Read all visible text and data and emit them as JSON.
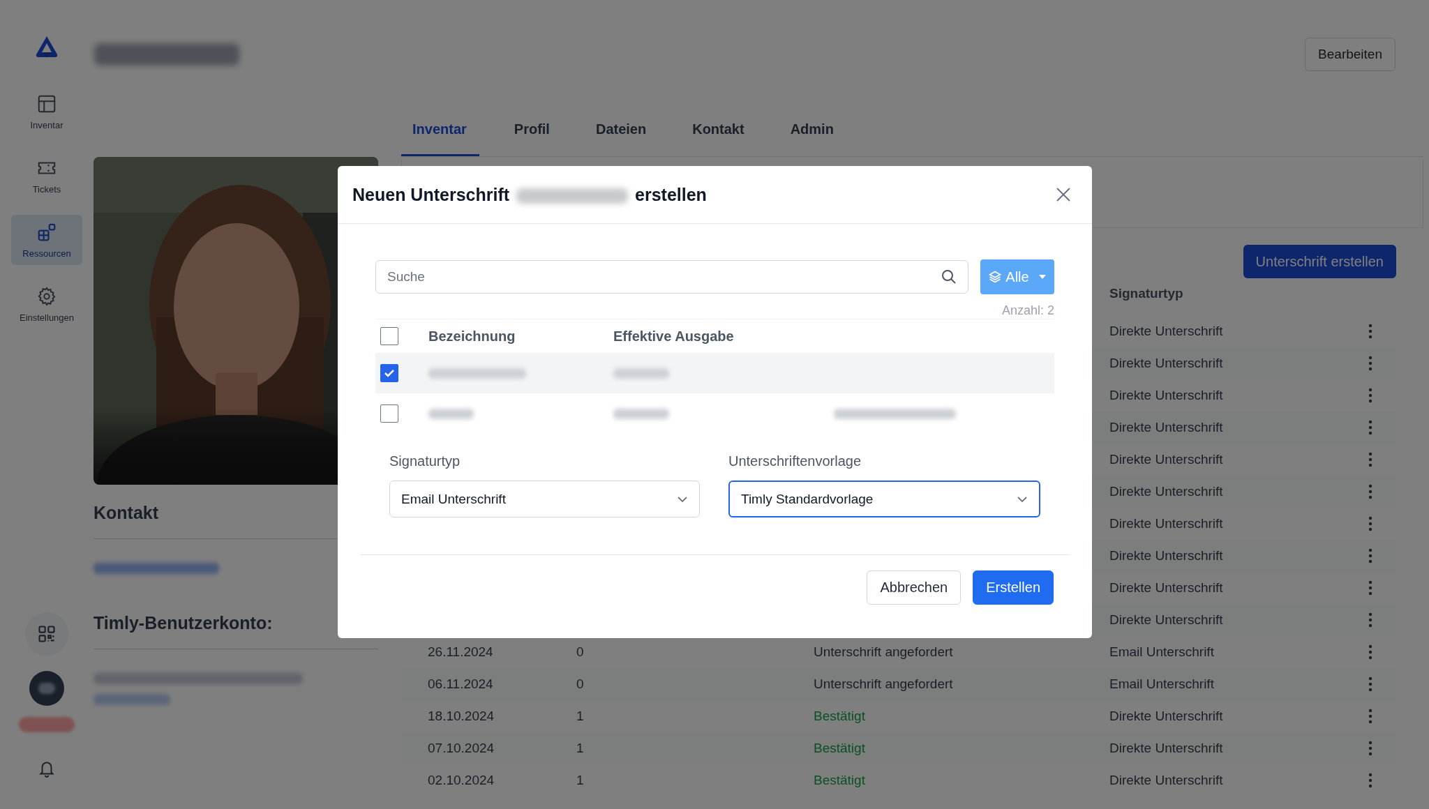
{
  "sidebar": {
    "items": [
      {
        "label": "Inventar",
        "selected": false
      },
      {
        "label": "Tickets",
        "selected": false
      },
      {
        "label": "Ressourcen",
        "selected": true
      },
      {
        "label": "Einstellungen",
        "selected": false
      }
    ]
  },
  "header": {
    "edit_button": "Bearbeiten"
  },
  "tabs": [
    {
      "label": "Inventar",
      "selected": true
    },
    {
      "label": "Profil",
      "selected": false
    },
    {
      "label": "Dateien",
      "selected": false
    },
    {
      "label": "Kontakt",
      "selected": false
    },
    {
      "label": "Admin",
      "selected": false
    }
  ],
  "profile": {
    "contact_heading": "Kontakt",
    "account_heading": "Timly-Benutzerkonto:"
  },
  "signatures": {
    "create_button": "Unterschrift erstellen",
    "type_column": "Signaturtyp",
    "rows": [
      {
        "type": "Direkte Unterschrift"
      },
      {
        "type": "Direkte Unterschrift"
      },
      {
        "type": "Direkte Unterschrift"
      },
      {
        "type": "Direkte Unterschrift"
      },
      {
        "type": "Direkte Unterschrift"
      },
      {
        "type": "Direkte Unterschrift"
      },
      {
        "type": "Direkte Unterschrift"
      },
      {
        "type": "Direkte Unterschrift"
      },
      {
        "type": "Direkte Unterschrift"
      },
      {
        "type": "Direkte Unterschrift"
      },
      {
        "date": "26.11.2024",
        "count": "0",
        "status": "Unterschrift angefordert",
        "confirmed": false,
        "type": "Email Unterschrift"
      },
      {
        "date": "06.11.2024",
        "count": "0",
        "status": "Unterschrift angefordert",
        "confirmed": false,
        "type": "Email Unterschrift"
      },
      {
        "date": "18.10.2024",
        "count": "1",
        "status": "Bestätigt",
        "confirmed": true,
        "type": "Direkte Unterschrift"
      },
      {
        "date": "07.10.2024",
        "count": "1",
        "status": "Bestätigt",
        "confirmed": true,
        "type": "Direkte Unterschrift"
      },
      {
        "date": "02.10.2024",
        "count": "1",
        "status": "Bestätigt",
        "confirmed": true,
        "type": "Direkte Unterschrift"
      }
    ]
  },
  "dialog": {
    "title_before": "Neuen Unterschrift",
    "title_after": "erstellen",
    "search": {
      "placeholder": "Suche"
    },
    "filter_button": "Alle",
    "count": "Anzahl: 2",
    "select_all": {
      "checked": false
    },
    "columns": [
      "Bezeichnung",
      "Effektive Ausgabe"
    ],
    "rows": [
      {
        "checked": true
      },
      {
        "checked": false
      }
    ],
    "fields": [
      {
        "label": "Signaturtyp",
        "value": "Email Unterschrift",
        "focused": false
      },
      {
        "label": "Unterschriftenvorlage",
        "value": "Timly Standardvorlage",
        "focused": true
      }
    ],
    "buttons": [
      {
        "label": "Abbrechen",
        "kind": "secondary"
      },
      {
        "label": "Erstellen",
        "kind": "primary"
      }
    ]
  }
}
